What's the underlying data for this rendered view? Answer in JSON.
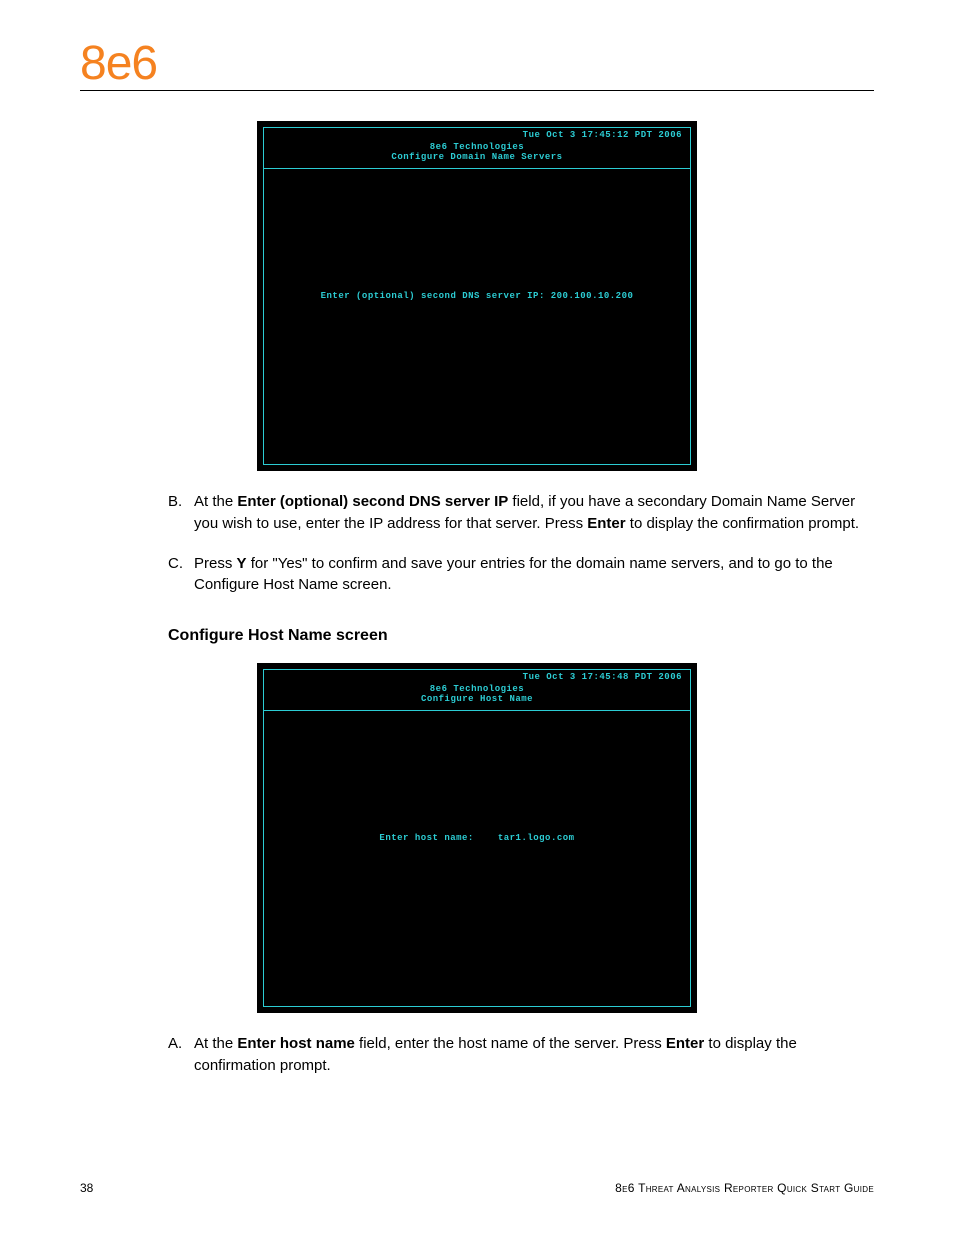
{
  "logo": "8e6",
  "terminal1": {
    "date": "Tue Oct  3 17:45:12 PDT 2006",
    "title1": "8e6 Technologies",
    "title2": "Configure Domain Name Servers",
    "prompt": "Enter (optional) second DNS server IP: 200.100.10.200"
  },
  "stepB": {
    "letter": "B.",
    "pre": "At the ",
    "bold1": "Enter (optional) second DNS server IP",
    "mid": " field, if you have a secondary Domain Name Server you wish to use, enter the IP address for that server. Press ",
    "bold2": "Enter",
    "post": " to display the confirmation prompt."
  },
  "stepC": {
    "letter": "C.",
    "pre": "Press ",
    "bold1": "Y",
    "post": " for \"Yes\" to confirm and save your entries for the domain name servers, and to go to the Configure Host Name screen."
  },
  "sectionHeading": "Configure Host Name screen",
  "terminal2": {
    "date": "Tue Oct  3 17:45:48 PDT 2006",
    "title1": "8e6 Technologies",
    "title2": "Configure Host Name",
    "promptLabel": "Enter host name:",
    "promptValue": "tar1.logo.com"
  },
  "stepA": {
    "letter": "A.",
    "pre": "At the ",
    "bold1": "Enter host name",
    "mid": " field, enter the host name of the server. Press ",
    "bold2": "Enter",
    "post": " to display the confirmation prompt."
  },
  "footer": {
    "pageNum": "38",
    "guide": "8e6 Threat Analysis Reporter Quick Start Guide"
  }
}
